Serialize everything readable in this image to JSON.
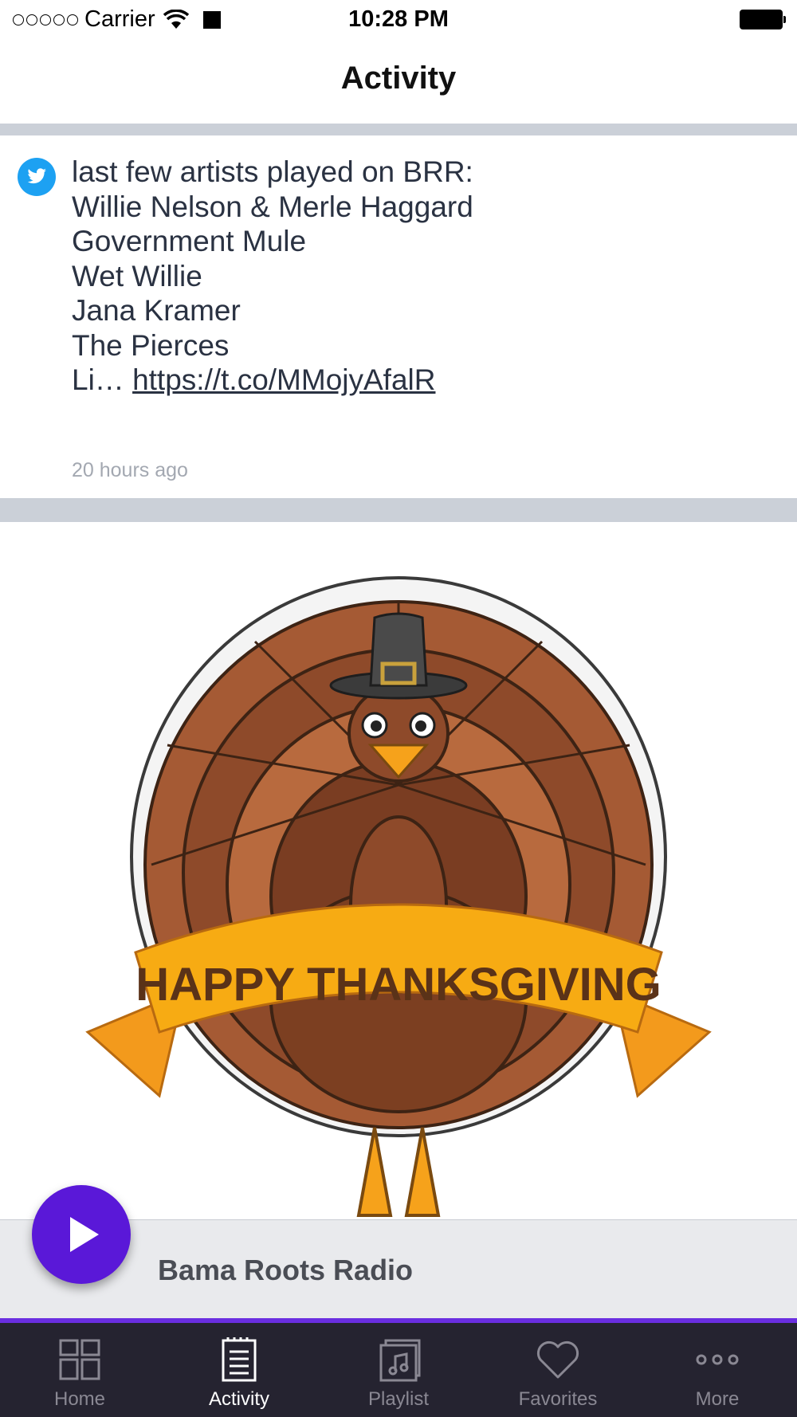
{
  "status_bar": {
    "carrier": "Carrier",
    "time": "10:28 PM"
  },
  "nav": {
    "title": "Activity"
  },
  "tweet": {
    "lines": [
      "last few artists played on BRR:",
      "Willie Nelson & Merle Haggard",
      "Government Mule",
      "Wet Willie",
      "Jana Kramer",
      "The Pierces"
    ],
    "last_line_prefix": "Li… ",
    "link": "https://t.co/MMojyAfalR",
    "timestamp": "20 hours ago",
    "icon": "twitter-icon"
  },
  "image": {
    "banner_text": "HAPPY THANKSGIVING"
  },
  "player": {
    "station": "Bama Roots Radio",
    "play_icon": "play-icon",
    "button_color": "#5a18d8"
  },
  "tab_bar": {
    "accent_color": "#6a2ee0",
    "tabs": [
      {
        "label": "Home",
        "icon": "home-grid-icon"
      },
      {
        "label": "Activity",
        "icon": "activity-list-icon"
      },
      {
        "label": "Playlist",
        "icon": "playlist-music-icon"
      },
      {
        "label": "Favorites",
        "icon": "heart-icon"
      },
      {
        "label": "More",
        "icon": "more-dots-icon"
      }
    ],
    "active": "Activity"
  }
}
